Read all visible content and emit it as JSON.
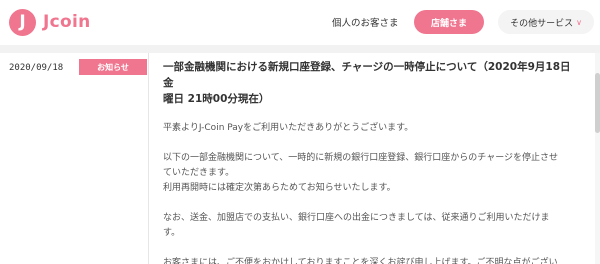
{
  "header": {
    "logo_mark": "J",
    "logo_text": "Jcoin",
    "nav_personal": "個人のお客さま",
    "btn_stores": "店舗さま",
    "btn_other": "その他サービス",
    "other_chevron": "∨"
  },
  "notice": {
    "date": "2020/09/18",
    "category": "お知らせ",
    "title_line1": "一部金融機関における新規口座登録、チャージの一時停止について（2020年9月18日 金",
    "title_line2": "曜日 21時00分現在）",
    "paragraphs": [
      "平素よりJ-Coin Payをご利用いただきありがとうございます。",
      "以下の一部金融機関について、一時的に新規の銀行口座登録、銀行口座からのチャージを停止させ",
      "ていただきます。",
      "利用再開時には確定次第あらためてお知らせいたします。",
      "なお、送金、加盟店での支払い、銀行口座への出金につきましては、従来通りご利用いただけま",
      "す。",
      "お客さまには、ご不便をおかけしておりますことを深くお詫び申し上げます。ご不明な点がござい"
    ]
  },
  "colors": {
    "accent": "#f0758f",
    "band": "#f2f2f2",
    "text": "#333333"
  }
}
